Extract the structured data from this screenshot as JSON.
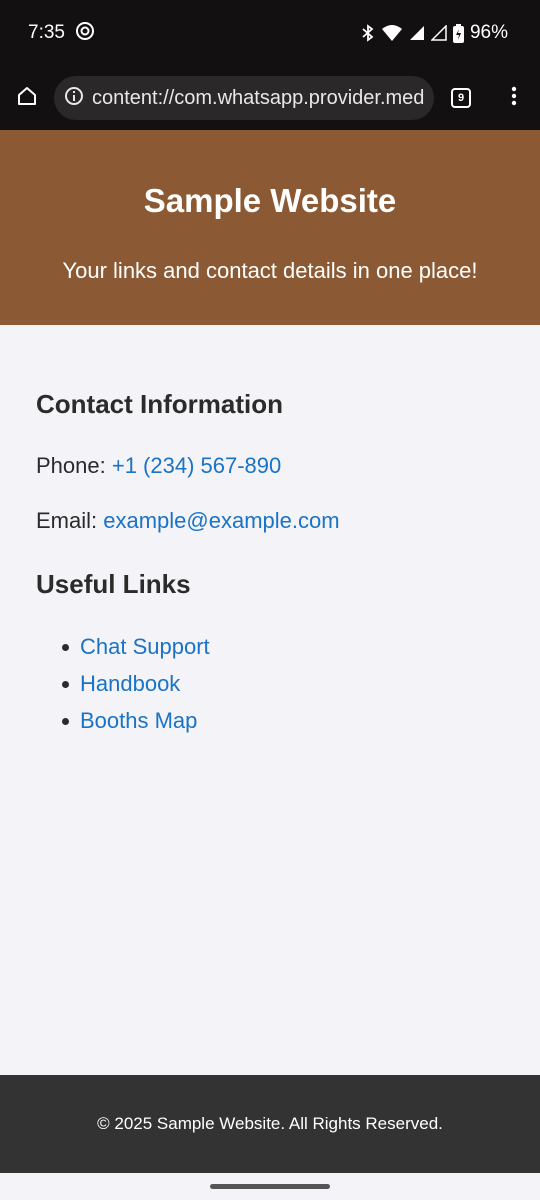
{
  "status_bar": {
    "time": "7:35",
    "battery": "96%"
  },
  "browser": {
    "url": "content://com.whatsapp.provider.media/item/...",
    "tab_count": "9"
  },
  "header": {
    "title": "Sample Website",
    "tagline": "Your links and contact details in one place!"
  },
  "contact": {
    "heading": "Contact Information",
    "phone_label": "Phone:",
    "phone_value": "+1 (234) 567-890",
    "email_label": "Email:",
    "email_value": "example@example.com"
  },
  "links": {
    "heading": "Useful Links",
    "items": [
      {
        "label": "Chat Support"
      },
      {
        "label": "Handbook"
      },
      {
        "label": "Booths Map"
      }
    ]
  },
  "footer": {
    "text": "© 2025 Sample Website. All Rights Reserved."
  },
  "colors": {
    "header_bg": "#8b5a34",
    "link": "#1a73c6",
    "footer_bg": "#333333",
    "page_bg": "#f3f3f8"
  }
}
